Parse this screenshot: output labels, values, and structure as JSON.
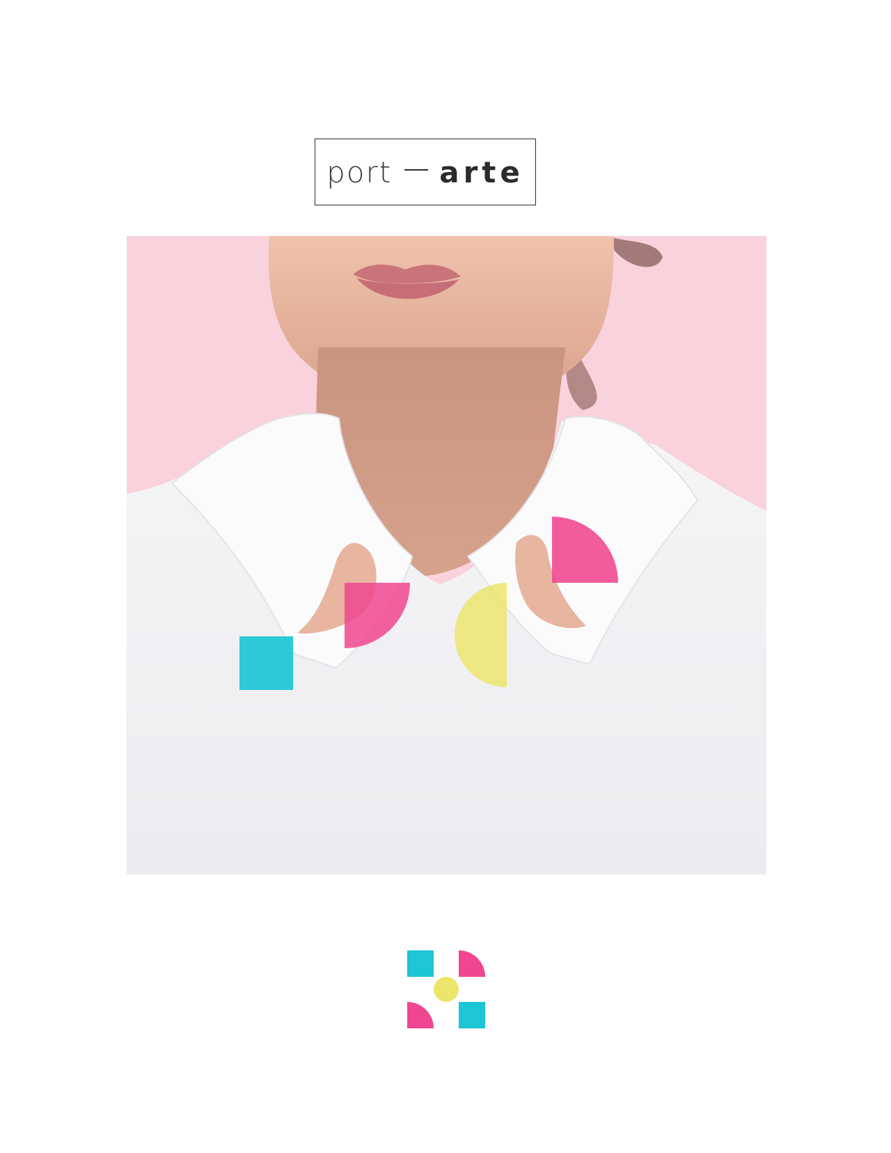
{
  "logo": {
    "light_text": "port",
    "bold_text": "arte"
  },
  "hero": {
    "background": "#f9d2dc",
    "shirt": "#f6f6f8",
    "skin": "#e8b9a2"
  },
  "colors": {
    "cyan": "#1cc6d4",
    "magenta": "#f0468f",
    "yellow": "#ece56c",
    "text": "#2b2b2b"
  },
  "icons": [
    "cyan-square-icon",
    "magenta-quarter-circle-icon",
    "yellow-circle-icon",
    "magenta-quarter-circle-icon",
    "cyan-square-icon"
  ]
}
